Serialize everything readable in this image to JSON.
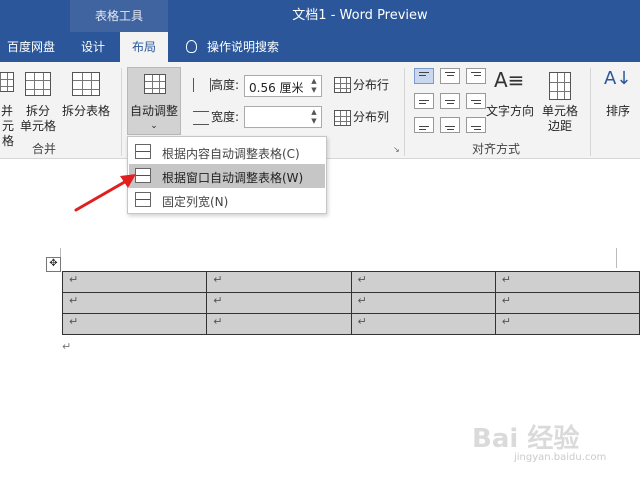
{
  "titlebar": {
    "context_tab": "表格工具",
    "doc_title": "文档1 - Word Preview"
  },
  "tabs": [
    {
      "label": "百度网盘"
    },
    {
      "label": "设计"
    },
    {
      "label": "布局",
      "active": true
    }
  ],
  "tellme": {
    "label": "操作说明搜索",
    "icon": "lightbulb-icon"
  },
  "ribbon": {
    "merge_group": {
      "label": "合并",
      "partial_btn_line1": "并",
      "partial_btn_line2": "元格",
      "split_cells_line1": "拆分",
      "split_cells_line2": "单元格",
      "split_table": "拆分表格"
    },
    "cellsize_group": {
      "autofit": "自动调整",
      "height_label": "高度:",
      "height_value": "0.56 厘米",
      "width_label": "宽度:",
      "width_value": "",
      "distribute_rows": "分布行",
      "distribute_cols": "分布列"
    },
    "alignment_group": {
      "label": "对齐方式",
      "text_direction": "文字方向",
      "cell_margins_line1": "单元格",
      "cell_margins_line2": "边距"
    },
    "sort": "排序"
  },
  "autofit_menu": [
    {
      "label": "根据内容自动调整表格(C)",
      "highlighted": false
    },
    {
      "label": "根据窗口自动调整表格(W)",
      "highlighted": true
    },
    {
      "label": "固定列宽(N)",
      "highlighted": false
    }
  ],
  "document": {
    "paragraph_mark": "↵",
    "table": {
      "rows": [
        [
          "↵",
          "↵",
          "↵",
          "↵"
        ],
        [
          "↵",
          "↵",
          "↵",
          "↵"
        ],
        [
          "↵",
          "↵",
          "↵",
          "↵"
        ]
      ]
    },
    "after_table_mark": "↵"
  },
  "watermark": {
    "text": "Bai 经验",
    "url": "jingyan.baidu.com"
  },
  "colors": {
    "accent": "#2b579a",
    "ribbon_bg": "#f3f3f3",
    "table_fill": "#cfcfcf",
    "arrow": "#e02020"
  }
}
